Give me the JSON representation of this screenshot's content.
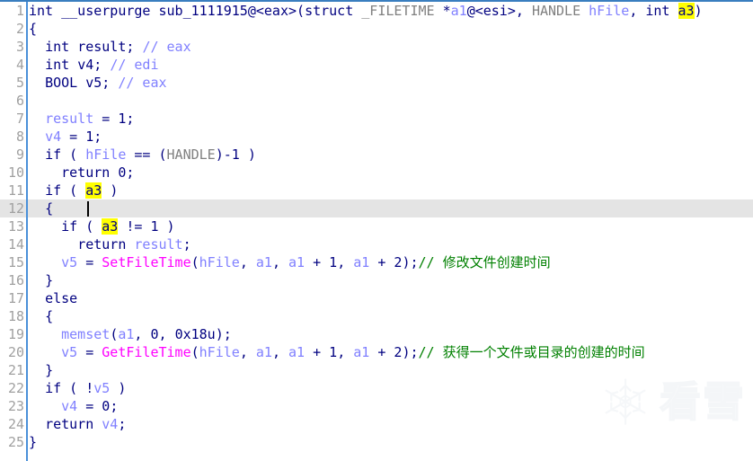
{
  "editor": {
    "kind": "hexrays-pseudocode-view",
    "gutter_rule_color": "#4a90d9",
    "current_line": 12,
    "caret_line": 12,
    "caret_column": 9,
    "highlight_token": "a3",
    "highlight_color": "#ffff00",
    "current_line_color": "#e4e4e4",
    "colors": {
      "keyword": "#000080",
      "variable": "#8080ff",
      "type": "#808080",
      "api_call": "#ff00ff",
      "comment": "#008000",
      "line_number": "#a0a0a0",
      "background": "#ffffff"
    },
    "line_numbers": [
      1,
      2,
      3,
      4,
      5,
      6,
      7,
      8,
      9,
      10,
      11,
      12,
      13,
      14,
      15,
      16,
      17,
      18,
      19,
      20,
      21,
      22,
      23,
      24,
      25
    ],
    "lines": [
      {
        "n": 1,
        "text": "int __userpurge sub_1111915@<eax>(struct _FILETIME *a1@<esi>, HANDLE hFile, int a3)"
      },
      {
        "n": 2,
        "text": "{"
      },
      {
        "n": 3,
        "text": "  int result; // eax"
      },
      {
        "n": 4,
        "text": "  int v4; // edi"
      },
      {
        "n": 5,
        "text": "  BOOL v5; // eax"
      },
      {
        "n": 6,
        "text": ""
      },
      {
        "n": 7,
        "text": "  result = 1;"
      },
      {
        "n": 8,
        "text": "  v4 = 1;"
      },
      {
        "n": 9,
        "text": "  if ( hFile == (HANDLE)-1 )"
      },
      {
        "n": 10,
        "text": "    return 0;"
      },
      {
        "n": 11,
        "text": "  if ( a3 )"
      },
      {
        "n": 12,
        "text": "  {"
      },
      {
        "n": 13,
        "text": "    if ( a3 != 1 )"
      },
      {
        "n": 14,
        "text": "      return result;"
      },
      {
        "n": 15,
        "text": "    v5 = SetFileTime(hFile, a1, a1 + 1, a1 + 2);// 修改文件创建时间"
      },
      {
        "n": 16,
        "text": "  }"
      },
      {
        "n": 17,
        "text": "  else"
      },
      {
        "n": 18,
        "text": "  {"
      },
      {
        "n": 19,
        "text": "    memset(a1, 0, 0x18u);"
      },
      {
        "n": 20,
        "text": "    v5 = GetFileTime(hFile, a1, a1 + 1, a1 + 2);// 获得一个文件或目录的创建的时间"
      },
      {
        "n": 21,
        "text": "  }"
      },
      {
        "n": 22,
        "text": "  if ( !v5 )"
      },
      {
        "n": 23,
        "text": "    v4 = 0;"
      },
      {
        "n": 24,
        "text": "  return v4;"
      },
      {
        "n": 25,
        "text": "}"
      }
    ],
    "comments": [
      {
        "line": 3,
        "text": "// eax"
      },
      {
        "line": 4,
        "text": "// edi"
      },
      {
        "line": 5,
        "text": "// eax"
      },
      {
        "line": 15,
        "text": "// 修改文件创建时间"
      },
      {
        "line": 20,
        "text": "// 获得一个文件或目录的创建的时间"
      }
    ],
    "function": {
      "return_type": "int",
      "calling_convention": "__userpurge",
      "name": "sub_1111915",
      "return_register": "@<eax>",
      "parameters": [
        "struct _FILETIME *a1@<esi>",
        "HANDLE hFile",
        "int a3"
      ]
    },
    "api_calls": [
      "SetFileTime",
      "GetFileTime",
      "memset"
    ]
  },
  "watermark": {
    "icon": "snowflake-icon",
    "text": "看雪",
    "color": "#fafbfc"
  }
}
